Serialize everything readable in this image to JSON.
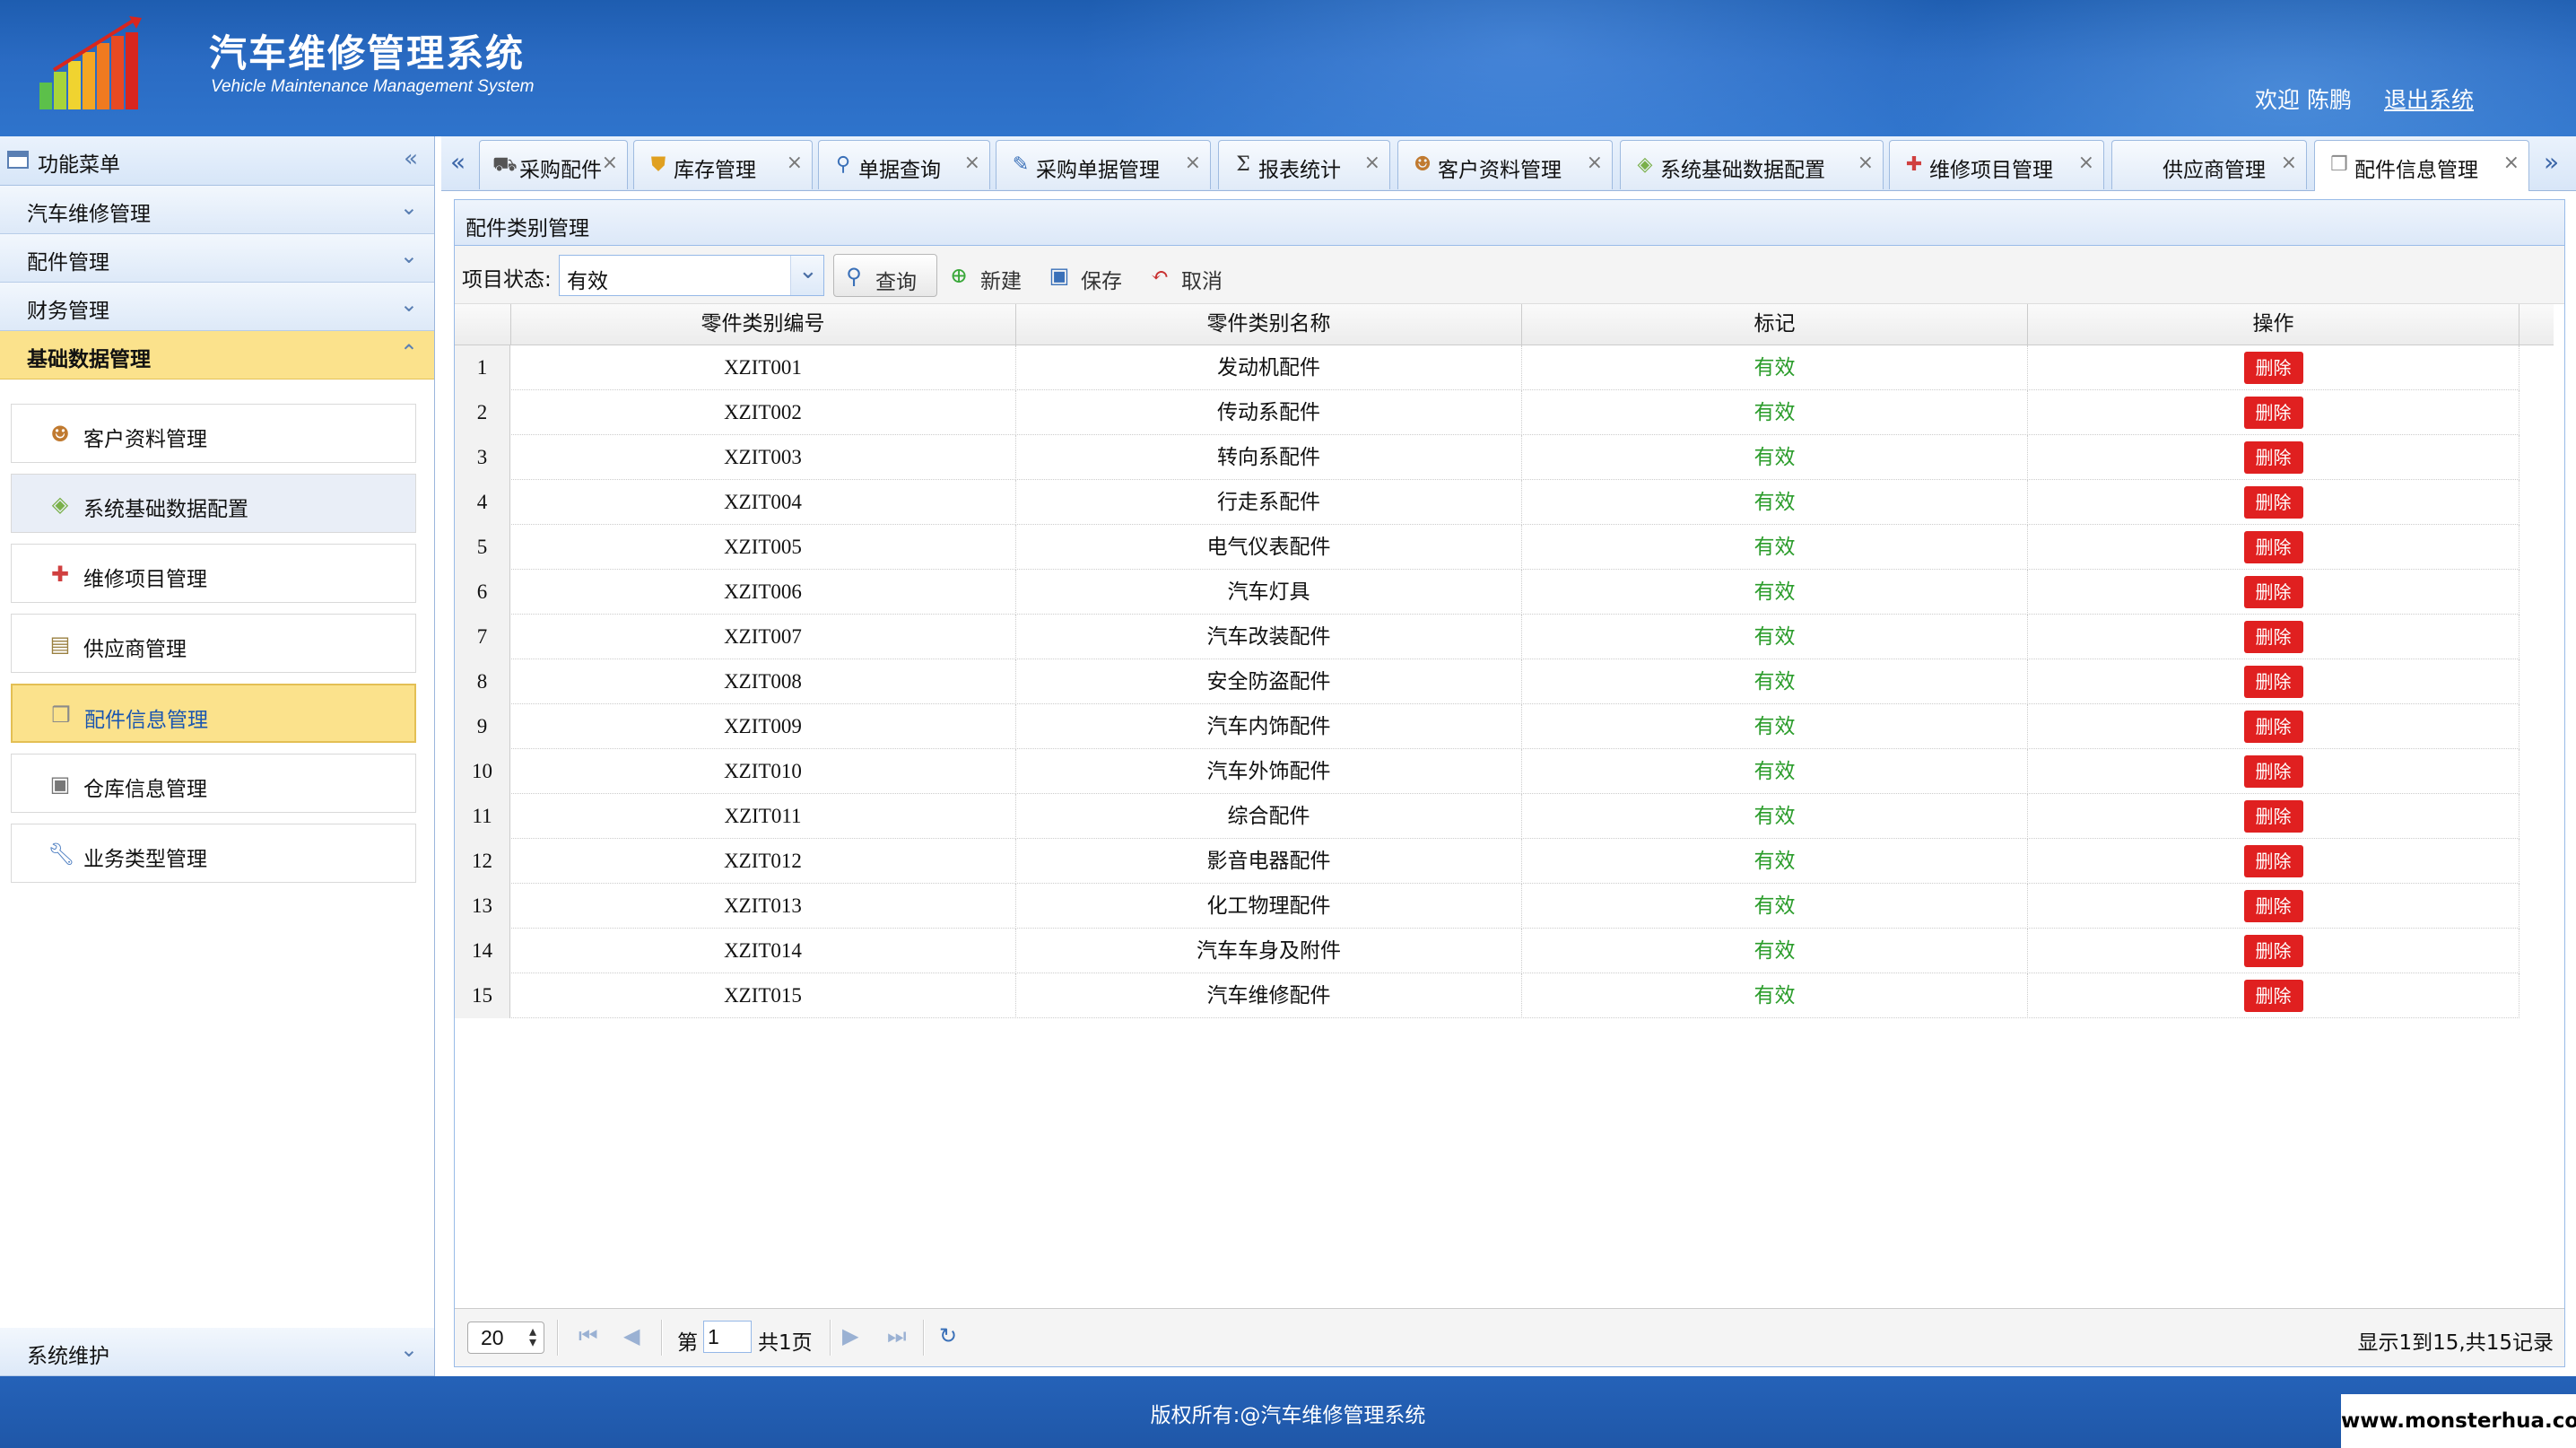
{
  "header": {
    "title": "汽车维修管理系统",
    "subtitle": "Vehicle Maintenance Management System",
    "welcome": "欢迎 陈鹏",
    "logout": "退出系统"
  },
  "sidebar": {
    "title": "功能菜单",
    "sections": [
      {
        "label": "汽车维修管理"
      },
      {
        "label": "配件管理"
      },
      {
        "label": "财务管理"
      },
      {
        "label": "基础数据管理"
      }
    ],
    "items": [
      {
        "label": "客户资料管理",
        "icon": "customer-icon"
      },
      {
        "label": "系统基础数据配置",
        "icon": "tag-icon"
      },
      {
        "label": "维修项目管理",
        "icon": "repair-icon"
      },
      {
        "label": "供应商管理",
        "icon": "document-icon"
      },
      {
        "label": "配件信息管理",
        "icon": "parts-icon"
      },
      {
        "label": "仓库信息管理",
        "icon": "warehouse-icon"
      },
      {
        "label": "业务类型管理",
        "icon": "wrench-icon"
      }
    ],
    "bottom": "系统维护"
  },
  "tabs": [
    {
      "label": "采购配件",
      "icon": "cart-icon"
    },
    {
      "label": "库存管理",
      "icon": "shield-icon"
    },
    {
      "label": "单据查询",
      "icon": "search-icon"
    },
    {
      "label": "采购单据管理",
      "icon": "edit-doc-icon"
    },
    {
      "label": "报表统计",
      "icon": "sigma-icon"
    },
    {
      "label": "客户资料管理",
      "icon": "customer-icon"
    },
    {
      "label": "系统基础数据配置",
      "icon": "tag-icon"
    },
    {
      "label": "维修项目管理",
      "icon": "repair-icon"
    },
    {
      "label": "供应商管理",
      "icon": ""
    },
    {
      "label": "配件信息管理",
      "icon": "parts-icon"
    }
  ],
  "panel": {
    "title": "配件类别管理",
    "filter_label": "项目状态:",
    "filter_value": "有效",
    "buttons": {
      "query": "查询",
      "new": "新建",
      "save": "保存",
      "cancel": "取消"
    }
  },
  "table": {
    "columns": [
      "零件类别编号",
      "零件类别名称",
      "标记",
      "操作"
    ],
    "delete_label": "删除",
    "rows": [
      {
        "no": "1",
        "code": "XZIT001",
        "name": "发动机配件",
        "status": "有效"
      },
      {
        "no": "2",
        "code": "XZIT002",
        "name": "传动系配件",
        "status": "有效"
      },
      {
        "no": "3",
        "code": "XZIT003",
        "name": "转向系配件",
        "status": "有效"
      },
      {
        "no": "4",
        "code": "XZIT004",
        "name": "行走系配件",
        "status": "有效"
      },
      {
        "no": "5",
        "code": "XZIT005",
        "name": "电气仪表配件",
        "status": "有效"
      },
      {
        "no": "6",
        "code": "XZIT006",
        "name": "汽车灯具",
        "status": "有效"
      },
      {
        "no": "7",
        "code": "XZIT007",
        "name": "汽车改装配件",
        "status": "有效"
      },
      {
        "no": "8",
        "code": "XZIT008",
        "name": "安全防盗配件",
        "status": "有效"
      },
      {
        "no": "9",
        "code": "XZIT009",
        "name": "汽车内饰配件",
        "status": "有效"
      },
      {
        "no": "10",
        "code": "XZIT010",
        "name": "汽车外饰配件",
        "status": "有效"
      },
      {
        "no": "11",
        "code": "XZIT011",
        "name": "综合配件",
        "status": "有效"
      },
      {
        "no": "12",
        "code": "XZIT012",
        "name": "影音电器配件",
        "status": "有效"
      },
      {
        "no": "13",
        "code": "XZIT013",
        "name": "化工物理配件",
        "status": "有效"
      },
      {
        "no": "14",
        "code": "XZIT014",
        "name": "汽车车身及附件",
        "status": "有效"
      },
      {
        "no": "15",
        "code": "XZIT015",
        "name": "汽车维修配件",
        "status": "有效"
      }
    ]
  },
  "pager": {
    "page_size": "20",
    "page_prefix": "第",
    "page_value": "1",
    "page_suffix": "共1页",
    "info": "显示1到15,共15记录"
  },
  "footer": {
    "copyright": "版权所有:@汽车维修管理系统",
    "watermark": "www.monsterhua.com"
  },
  "colors": {
    "header": "#2a6bc3",
    "active": "#fbe28c",
    "status": "#2a9c2a",
    "delete": "#e02020"
  }
}
